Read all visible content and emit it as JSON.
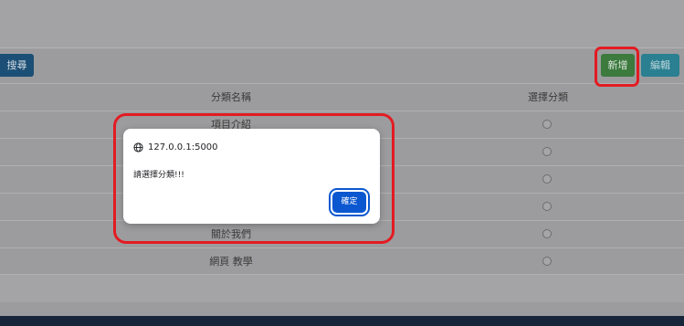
{
  "toolbar": {
    "search_label": "搜尋",
    "add_label": "新增",
    "edit_label": "編輯"
  },
  "table": {
    "headers": {
      "name": "分類名稱",
      "select": "選擇分類"
    },
    "rows": [
      {
        "name": "項目介紹"
      },
      {
        "name": ""
      },
      {
        "name": ""
      },
      {
        "name": ""
      },
      {
        "name": "關於我們"
      },
      {
        "name": "網頁 教學"
      }
    ]
  },
  "dialog": {
    "origin": "127.0.0.1:5000",
    "message": "請選擇分類!!!",
    "ok_label": "確定"
  },
  "icons": {
    "origin": "globe-icon",
    "radio": "radio-icon"
  },
  "colors": {
    "search_button": "#1c4f75",
    "add_button": "#3c7a3e",
    "edit_button": "#2a7f90",
    "highlight": "#e31b23",
    "dialog_ok": "#0b57d0",
    "footer": "#16253a"
  }
}
